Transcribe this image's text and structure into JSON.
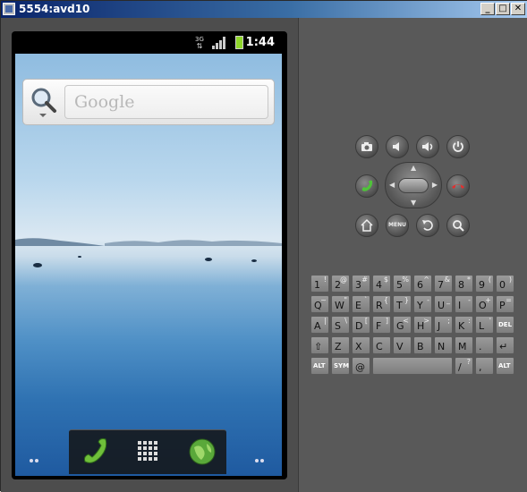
{
  "window": {
    "title": "5554:avd10",
    "buttons": {
      "minimize": "_",
      "maximize": "□",
      "close": "✕"
    }
  },
  "status_bar": {
    "time": "1:44",
    "network_label": "3G"
  },
  "search_widget": {
    "placeholder": "Google"
  },
  "dock": {
    "items": [
      "phone",
      "apps-grid",
      "browser"
    ]
  },
  "controls": {
    "menu_label": "MENU"
  },
  "keyboard": {
    "rows": [
      [
        {
          "k": "1",
          "a": "!"
        },
        {
          "k": "2",
          "a": "@"
        },
        {
          "k": "3",
          "a": "#"
        },
        {
          "k": "4",
          "a": "$"
        },
        {
          "k": "5",
          "a": "%"
        },
        {
          "k": "6",
          "a": "^"
        },
        {
          "k": "7",
          "a": "&"
        },
        {
          "k": "8",
          "a": "*"
        },
        {
          "k": "9",
          "a": "("
        },
        {
          "k": "0",
          "a": ")"
        }
      ],
      [
        {
          "k": "Q",
          "a": "~"
        },
        {
          "k": "W",
          "a": "\""
        },
        {
          "k": "E",
          "a": "`"
        },
        {
          "k": "R",
          "a": "{"
        },
        {
          "k": "T",
          "a": "}"
        },
        {
          "k": "Y",
          "a": "-"
        },
        {
          "k": "U",
          "a": "_"
        },
        {
          "k": "I",
          "a": "-"
        },
        {
          "k": "O",
          "a": "+"
        },
        {
          "k": "P",
          "a": "="
        }
      ],
      [
        {
          "k": "A",
          "a": "|"
        },
        {
          "k": "S",
          "a": "\\"
        },
        {
          "k": "D",
          "a": "["
        },
        {
          "k": "F",
          "a": "]"
        },
        {
          "k": "G",
          "a": "<"
        },
        {
          "k": "H",
          "a": ">"
        },
        {
          "k": "J",
          "a": ";"
        },
        {
          "k": "K",
          "a": ":"
        },
        {
          "k": "L",
          "a": "'"
        },
        {
          "k": "DEL",
          "a": ""
        }
      ],
      [
        {
          "k": "⇧",
          "a": ""
        },
        {
          "k": "Z",
          "a": ""
        },
        {
          "k": "X",
          "a": ""
        },
        {
          "k": "C",
          "a": ""
        },
        {
          "k": "V",
          "a": ""
        },
        {
          "k": "B",
          "a": ""
        },
        {
          "k": "N",
          "a": ""
        },
        {
          "k": "M",
          "a": ""
        },
        {
          "k": ".",
          "a": ""
        },
        {
          "k": "↵",
          "a": ""
        }
      ],
      [
        {
          "k": "ALT",
          "a": ""
        },
        {
          "k": "SYM",
          "a": ""
        },
        {
          "k": "@",
          "a": ""
        },
        {
          "k": "",
          "a": ""
        },
        {
          "k": "/",
          "a": "?"
        },
        {
          "k": ",",
          "a": ""
        },
        {
          "k": "ALT",
          "a": ""
        }
      ]
    ]
  }
}
